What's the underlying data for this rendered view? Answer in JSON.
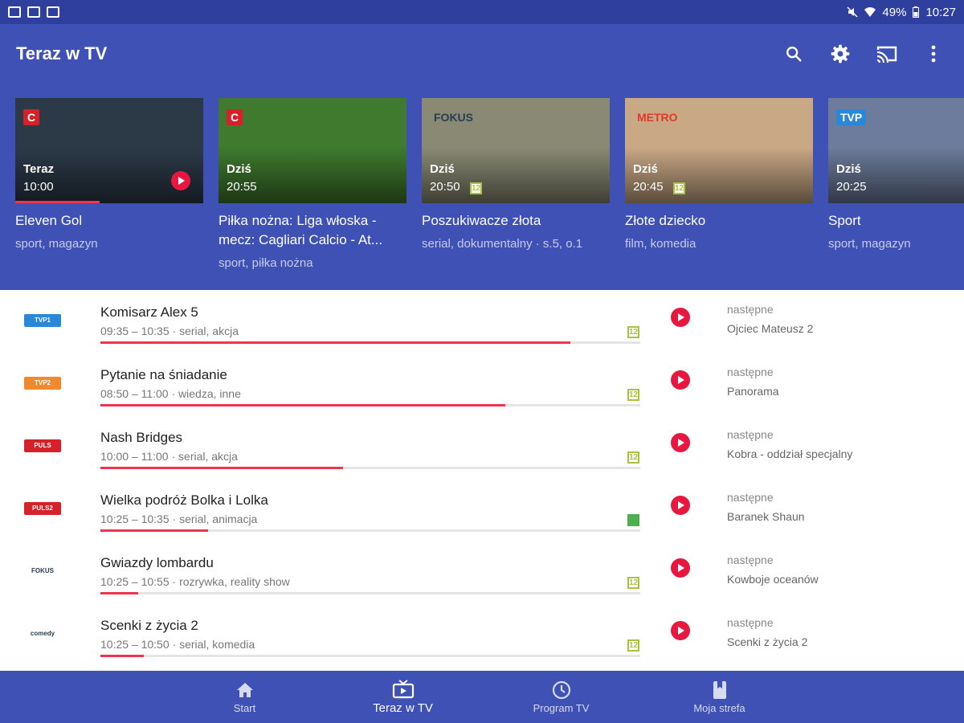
{
  "status_bar": {
    "battery": "49%",
    "time": "10:27"
  },
  "app_bar": {
    "title": "Teraz w TV"
  },
  "featured": [
    {
      "logo": "C",
      "when": "Teraz",
      "time": "10:00",
      "title": "Eleven Gol",
      "genre": "sport, magazyn",
      "age": "",
      "progress": 0.45,
      "playable": true,
      "bg": "#2c3a48",
      "logo_bg": "#d6202a",
      "logo_fg": "#ffffff"
    },
    {
      "logo": "C",
      "when": "Dziś",
      "time": "20:55",
      "title": "Piłka nożna: Liga włoska - mecz: Cagliari Calcio - At...",
      "genre": "sport, piłka nożna",
      "age": "",
      "progress": 0,
      "playable": false,
      "bg": "#3f7a2e",
      "logo_bg": "#d6202a",
      "logo_fg": "#ffffff"
    },
    {
      "logo": "FOKUS",
      "when": "Dziś",
      "time": "20:50",
      "title": "Poszukiwacze złota",
      "genre": "serial, dokumentalny · s.5, o.1",
      "age": "12",
      "progress": 0,
      "playable": false,
      "bg": "#8a8a74",
      "logo_bg": "transparent",
      "logo_fg": "#2b3d55"
    },
    {
      "logo": "METRO",
      "when": "Dziś",
      "time": "20:45",
      "title": "Złote dziecko",
      "genre": "film, komedia",
      "age": "12",
      "progress": 0,
      "playable": false,
      "bg": "#c9a886",
      "logo_bg": "transparent",
      "logo_fg": "#e23a2a"
    },
    {
      "logo": "TVP",
      "when": "Dziś",
      "time": "20:25",
      "title": "Sport",
      "genre": "sport, magazyn",
      "age": "",
      "progress": 0,
      "playable": false,
      "bg": "#6d7c9c",
      "logo_bg": "#2a88d8",
      "logo_fg": "#ffffff"
    }
  ],
  "programs": [
    {
      "channel": "TVP1",
      "channel_bg": "#2a88d8",
      "title": "Komisarz Alex 5",
      "meta": "09:35 – 10:35 · serial, akcja",
      "age": "12",
      "progress": 0.87,
      "next_label": "następne",
      "next_title": "Ojciec Mateusz 2"
    },
    {
      "channel": "TVP2",
      "channel_bg": "#f08a2c",
      "title": "Pytanie na śniadanie",
      "meta": "08:50 – 11:00 · wiedza, inne",
      "age": "12",
      "progress": 0.75,
      "next_label": "następne",
      "next_title": "Panorama"
    },
    {
      "channel": "PULS",
      "channel_bg": "#d6202a",
      "title": "Nash Bridges",
      "meta": "10:00 – 11:00 · serial, akcja",
      "age": "12",
      "progress": 0.45,
      "next_label": "następne",
      "next_title": "Kobra - oddział specjalny"
    },
    {
      "channel": "PULS2",
      "channel_bg": "#d6202a",
      "title": "Wielka podróż Bolka i Lolka",
      "meta": "10:25 – 10:35 · serial, animacja",
      "age": "kid",
      "progress": 0.2,
      "next_label": "następne",
      "next_title": "Baranek Shaun"
    },
    {
      "channel": "FOKUS",
      "channel_bg": "#ffffff",
      "title": "Gwiazdy lombardu",
      "meta": "10:25 – 10:55 · rozrywka, reality show",
      "age": "12",
      "progress": 0.07,
      "next_label": "następne",
      "next_title": "Kowboje oceanów"
    },
    {
      "channel": "comedy",
      "channel_bg": "#ffffff",
      "title": "Scenki z życia 2",
      "meta": "10:25 – 10:50 · serial, komedia",
      "age": "12",
      "progress": 0.08,
      "next_label": "następne",
      "next_title": "Scenki z życia 2"
    }
  ],
  "bottom_nav": [
    {
      "label": "Start",
      "icon": "home-icon",
      "active": false
    },
    {
      "label": "Teraz w TV",
      "icon": "tv-icon",
      "active": true
    },
    {
      "label": "Program TV",
      "icon": "clock-icon",
      "active": false
    },
    {
      "label": "Moja strefa",
      "icon": "bookmark-icon",
      "active": false
    }
  ],
  "colors": {
    "primary": "#3f51b5",
    "status_bar": "#2e3f9e",
    "accent": "#e8173f",
    "age_rating": "#a9c23f"
  }
}
